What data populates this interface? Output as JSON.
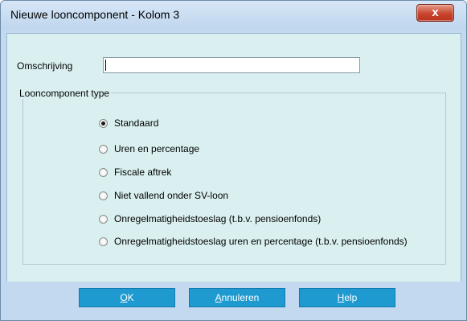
{
  "window": {
    "title": "Nieuwe looncomponent - Kolom 3",
    "close_label": "x"
  },
  "omschrijving": {
    "label": "Omschrijving",
    "value": ""
  },
  "type_group": {
    "label": "Looncomponent type",
    "options": [
      {
        "label": "Standaard",
        "selected": true
      },
      {
        "label": "Uren en percentage",
        "selected": false
      },
      {
        "label": "Fiscale aftrek",
        "selected": false
      },
      {
        "label": "Niet vallend onder SV-loon",
        "selected": false
      },
      {
        "label": "Onregelmatigheidstoeslag (t.b.v. pensioenfonds)",
        "selected": false
      },
      {
        "label": "Onregelmatigheidstoeslag uren en percentage (t.b.v. pensioenfonds)",
        "selected": false
      }
    ]
  },
  "buttons": {
    "ok": {
      "mnemonic": "O",
      "rest": "K"
    },
    "annuleren": {
      "mnemonic": "A",
      "rest": "nnuleren"
    },
    "help": {
      "mnemonic": "H",
      "rest": "elp"
    }
  },
  "colors": {
    "button_blue": "#1f9ad0",
    "client_bg": "#daf0f0",
    "frame_bg": "#c3d9ef",
    "close_red": "#c9452e"
  }
}
